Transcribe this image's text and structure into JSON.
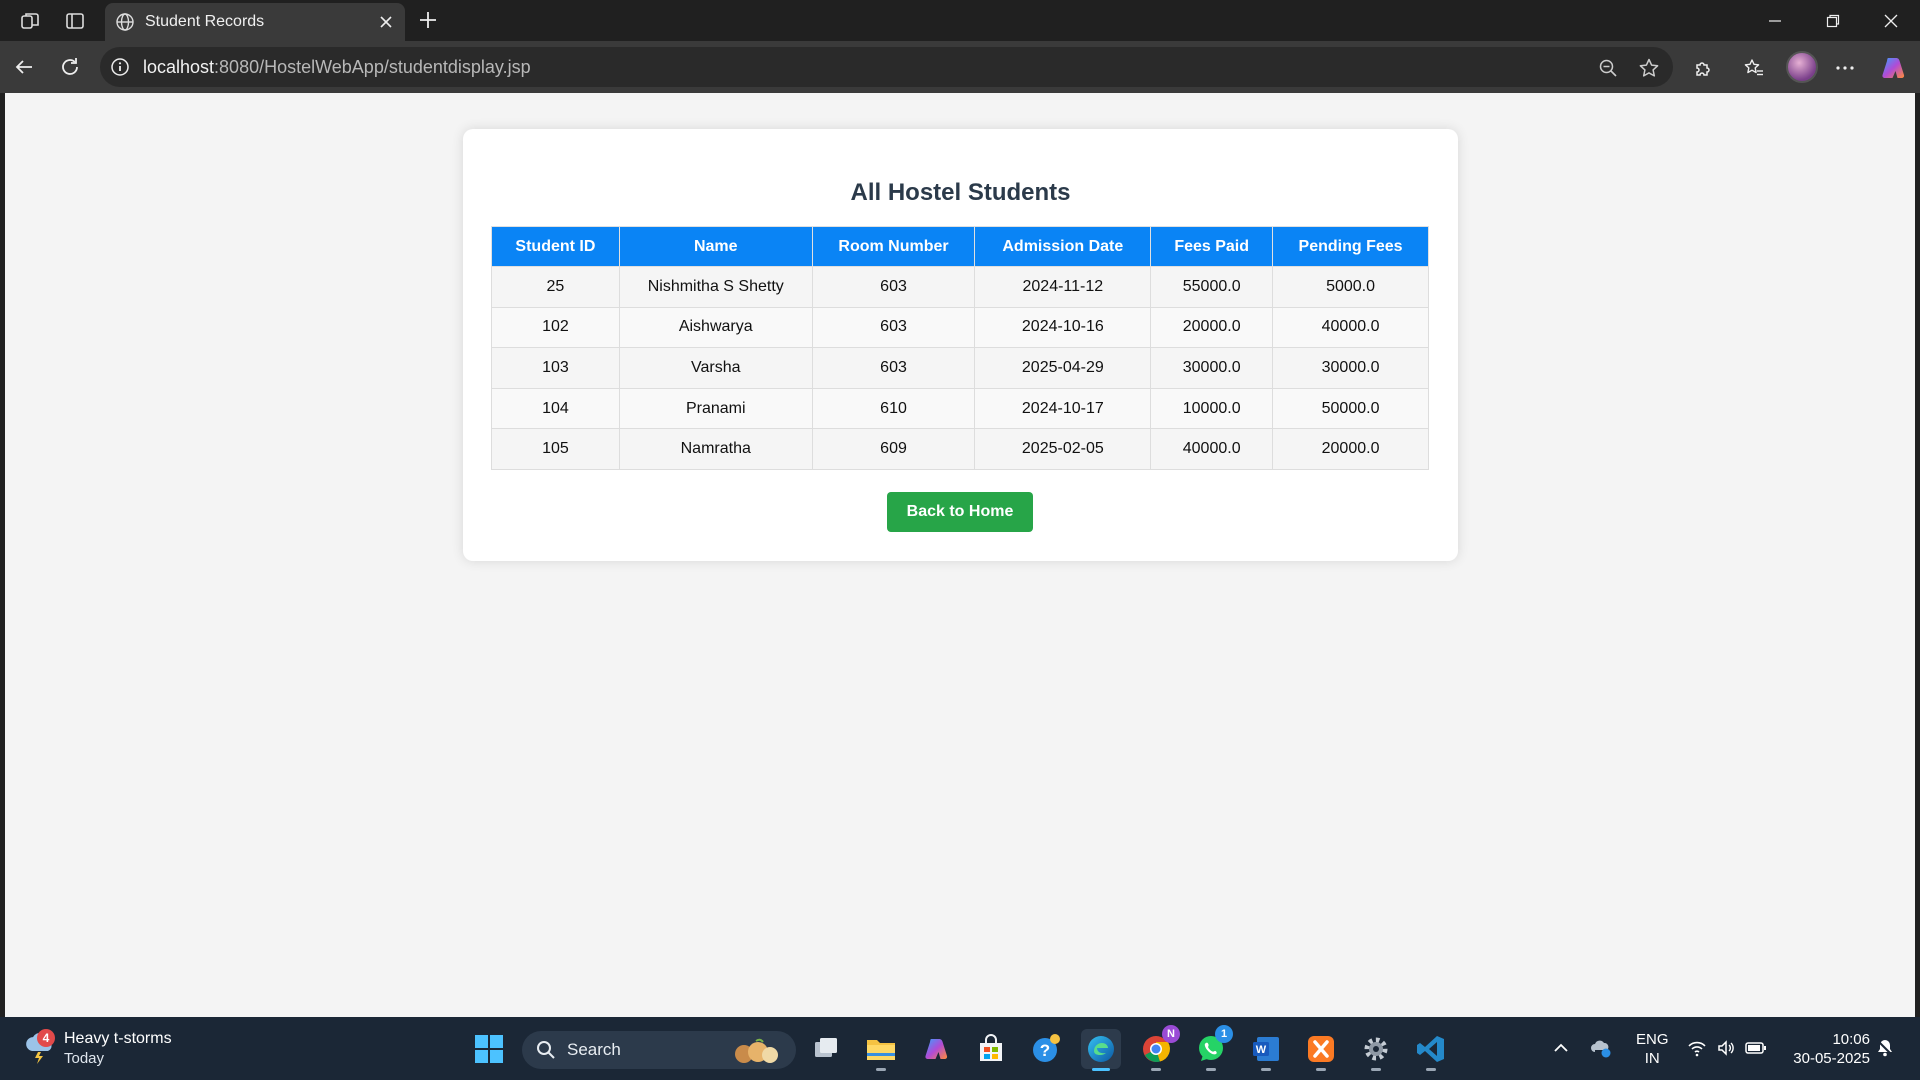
{
  "browser": {
    "tab_title": "Student Records",
    "url_host": "localhost",
    "url_path": ":8080/HostelWebApp/studentdisplay.jsp"
  },
  "page": {
    "title": "All Hostel Students",
    "columns": [
      "Student ID",
      "Name",
      "Room Number",
      "Admission Date",
      "Fees Paid",
      "Pending Fees"
    ],
    "rows": [
      [
        "25",
        "Nishmitha S Shetty",
        "603",
        "2024-11-12",
        "55000.0",
        "5000.0"
      ],
      [
        "102",
        "Aishwarya",
        "603",
        "2024-10-16",
        "20000.0",
        "40000.0"
      ],
      [
        "103",
        "Varsha",
        "603",
        "2025-04-29",
        "30000.0",
        "30000.0"
      ],
      [
        "104",
        "Pranami",
        "610",
        "2024-10-17",
        "10000.0",
        "50000.0"
      ],
      [
        "105",
        "Namratha",
        "609",
        "2025-02-05",
        "40000.0",
        "20000.0"
      ]
    ],
    "back_button": "Back to Home"
  },
  "taskbar": {
    "weather_badge": "4",
    "weather_title": "Heavy t-storms",
    "weather_sub": "Today",
    "search_label": "Search",
    "whatsapp_badge": "1",
    "chrome_badge": "N",
    "lang_line1": "ENG",
    "lang_line2": "IN",
    "time": "10:06",
    "date": "30-05-2025"
  },
  "colors": {
    "table_header": "#0a84f5",
    "button": "#27a548",
    "taskbar": "#1b2736",
    "browser_chrome": "#202020"
  }
}
